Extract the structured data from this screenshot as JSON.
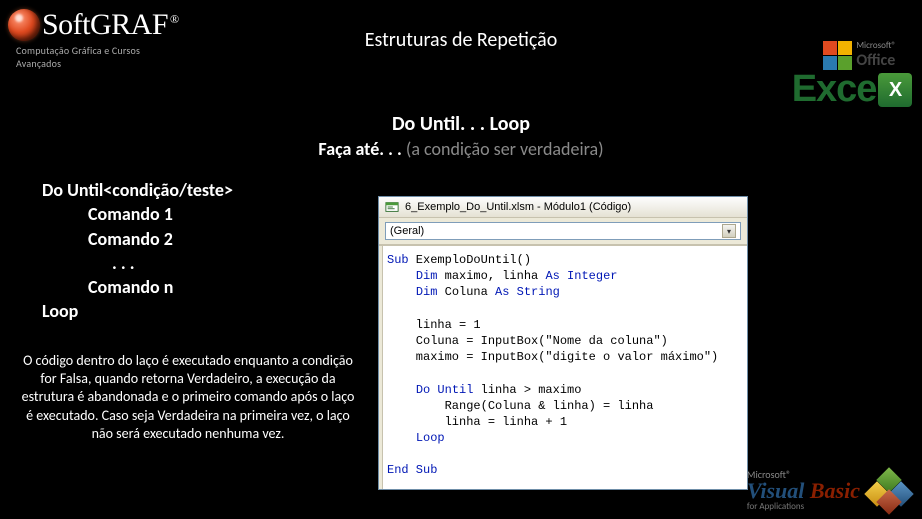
{
  "brand": {
    "name": "SoftGRAF",
    "registered": "®",
    "tagline": "Computação Gráfica e Cursos Avançados"
  },
  "title": "Estruturas de Repetição",
  "subhead": {
    "line1": "Do Until. . . Loop",
    "line2_bold": "Faça até. . . ",
    "line2_gray": "(a condição ser verdadeira)"
  },
  "syntax": {
    "l1": "Do Until<condição/teste>",
    "l2": "Comando 1",
    "l3": "Comando 2",
    "l4": ". . .",
    "l5": "Comando n",
    "l6": "Loop"
  },
  "explain": "O código dentro do laço é executado enquanto a condição for Falsa, quando retorna Verdadeiro, a execução da estrutura é abandonada e o primeiro comando após o laço é executado. Caso seja Verdadeira na primeira vez, o laço não será executado nenhuma vez.",
  "vba_window": {
    "title": "6_Exemplo_Do_Until.xlsm - Módulo1 (Código)",
    "dropdown_left": "(Geral)",
    "code_lines": [
      {
        "t": "Sub",
        "k": true
      },
      {
        "t": " ExemploDoUntil()"
      },
      {
        "br": true
      },
      {
        "i": 1
      },
      {
        "t": "Dim",
        "k": true
      },
      {
        "t": " maximo, linha "
      },
      {
        "t": "As Integer",
        "k": true
      },
      {
        "br": true
      },
      {
        "i": 1
      },
      {
        "t": "Dim",
        "k": true
      },
      {
        "t": " Coluna "
      },
      {
        "t": "As String",
        "k": true
      },
      {
        "br": true
      },
      {
        "blank": true
      },
      {
        "br": true
      },
      {
        "i": 1
      },
      {
        "t": "linha = 1"
      },
      {
        "br": true
      },
      {
        "i": 1
      },
      {
        "t": "Coluna = InputBox(\"Nome da coluna\")"
      },
      {
        "br": true
      },
      {
        "i": 1
      },
      {
        "t": "maximo = InputBox(\"digite o valor máximo\")"
      },
      {
        "br": true
      },
      {
        "blank": true
      },
      {
        "br": true
      },
      {
        "i": 1
      },
      {
        "t": "Do Until",
        "k": true
      },
      {
        "t": " linha > maximo"
      },
      {
        "br": true
      },
      {
        "i": 2
      },
      {
        "t": "Range(Coluna & linha) = linha"
      },
      {
        "br": true
      },
      {
        "i": 2
      },
      {
        "t": "linha = linha + 1"
      },
      {
        "br": true
      },
      {
        "i": 1
      },
      {
        "t": "Loop",
        "k": true
      },
      {
        "br": true
      },
      {
        "blank": true
      },
      {
        "br": true
      },
      {
        "t": "End Sub",
        "k": true
      }
    ]
  },
  "excel_logo": {
    "ms": "Microsoft®",
    "office": "Office",
    "word": "Excel"
  },
  "vba_logo": {
    "ms": "Microsoft®",
    "visual": "Visual",
    "basic": "Basic",
    "apps": "for Applications"
  }
}
